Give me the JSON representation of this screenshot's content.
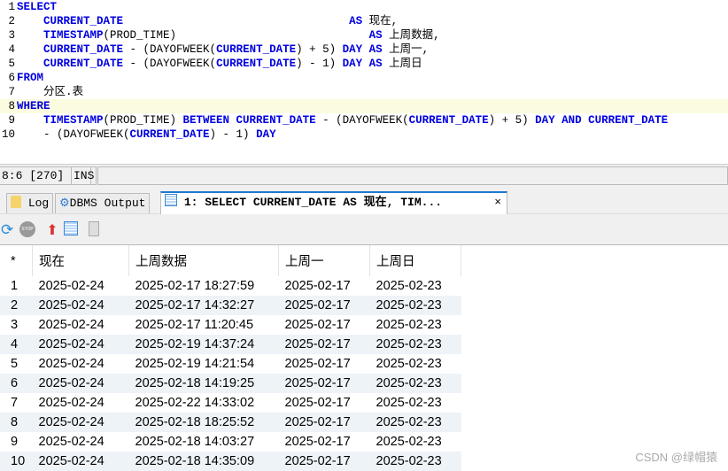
{
  "editor": {
    "lines": [
      [
        {
          "t": "SELECT",
          "k": "kw"
        }
      ],
      [
        {
          "t": "    "
        },
        {
          "t": "CURRENT_DATE",
          "k": "kw"
        },
        {
          "t": "                                  "
        },
        {
          "t": "AS",
          "k": "kw"
        },
        {
          "t": " 现在,"
        }
      ],
      [
        {
          "t": "    "
        },
        {
          "t": "TIMESTAMP",
          "k": "kw"
        },
        {
          "t": "(PROD_TIME)                             "
        },
        {
          "t": "AS",
          "k": "kw"
        },
        {
          "t": " 上周数据,"
        }
      ],
      [
        {
          "t": "    "
        },
        {
          "t": "CURRENT_DATE",
          "k": "kw"
        },
        {
          "t": " - (DAYOFWEEK("
        },
        {
          "t": "CURRENT_DATE",
          "k": "kw"
        },
        {
          "t": ") + 5) "
        },
        {
          "t": "DAY AS",
          "k": "kw"
        },
        {
          "t": " 上周一,"
        }
      ],
      [
        {
          "t": "    "
        },
        {
          "t": "CURRENT_DATE",
          "k": "kw"
        },
        {
          "t": " - (DAYOFWEEK("
        },
        {
          "t": "CURRENT_DATE",
          "k": "kw"
        },
        {
          "t": ") - 1) "
        },
        {
          "t": "DAY AS",
          "k": "kw"
        },
        {
          "t": " 上周日"
        }
      ],
      [
        {
          "t": "FROM",
          "k": "kw"
        }
      ],
      [
        {
          "t": "    分区.表"
        }
      ],
      [
        {
          "t": "WHERE",
          "k": "kw"
        }
      ],
      [
        {
          "t": "    "
        },
        {
          "t": "TIMESTAMP",
          "k": "kw"
        },
        {
          "t": "(PROD_TIME) "
        },
        {
          "t": "BETWEEN CURRENT_DATE",
          "k": "kw"
        },
        {
          "t": " - (DAYOFWEEK("
        },
        {
          "t": "CURRENT_DATE",
          "k": "kw"
        },
        {
          "t": ") + 5) "
        },
        {
          "t": "DAY AND CURRENT_DATE",
          "k": "kw"
        }
      ],
      [
        {
          "t": "    - (DAYOFWEEK("
        },
        {
          "t": "CURRENT_DATE",
          "k": "kw"
        },
        {
          "t": ") - 1) "
        },
        {
          "t": "DAY",
          "k": "kw"
        }
      ]
    ],
    "current_line": 8
  },
  "status": {
    "position": "8:6 [270]",
    "mode": "INS"
  },
  "tabs": {
    "log": "Log",
    "dbms": "DBMS Output",
    "result": "1: SELECT CURRENT_DATE AS 现在, TIM...",
    "close": "×"
  },
  "grid": {
    "corner": "*",
    "columns": [
      "现在",
      "上周数据",
      "上周一",
      "上周日"
    ],
    "rows": [
      [
        "1",
        "2025-02-24",
        "2025-02-17 18:27:59",
        "2025-02-17",
        "2025-02-23"
      ],
      [
        "2",
        "2025-02-24",
        "2025-02-17 14:32:27",
        "2025-02-17",
        "2025-02-23"
      ],
      [
        "3",
        "2025-02-24",
        "2025-02-17 11:20:45",
        "2025-02-17",
        "2025-02-23"
      ],
      [
        "4",
        "2025-02-24",
        "2025-02-19 14:37:24",
        "2025-02-17",
        "2025-02-23"
      ],
      [
        "5",
        "2025-02-24",
        "2025-02-19 14:21:54",
        "2025-02-17",
        "2025-02-23"
      ],
      [
        "6",
        "2025-02-24",
        "2025-02-18 14:19:25",
        "2025-02-17",
        "2025-02-23"
      ],
      [
        "7",
        "2025-02-24",
        "2025-02-22 14:33:02",
        "2025-02-17",
        "2025-02-23"
      ],
      [
        "8",
        "2025-02-24",
        "2025-02-18 18:25:52",
        "2025-02-17",
        "2025-02-23"
      ],
      [
        "9",
        "2025-02-24",
        "2025-02-18 14:03:27",
        "2025-02-17",
        "2025-02-23"
      ],
      [
        "10",
        "2025-02-24",
        "2025-02-18 14:35:09",
        "2025-02-17",
        "2025-02-23"
      ]
    ]
  },
  "watermark": "CSDN @绿帽猿"
}
